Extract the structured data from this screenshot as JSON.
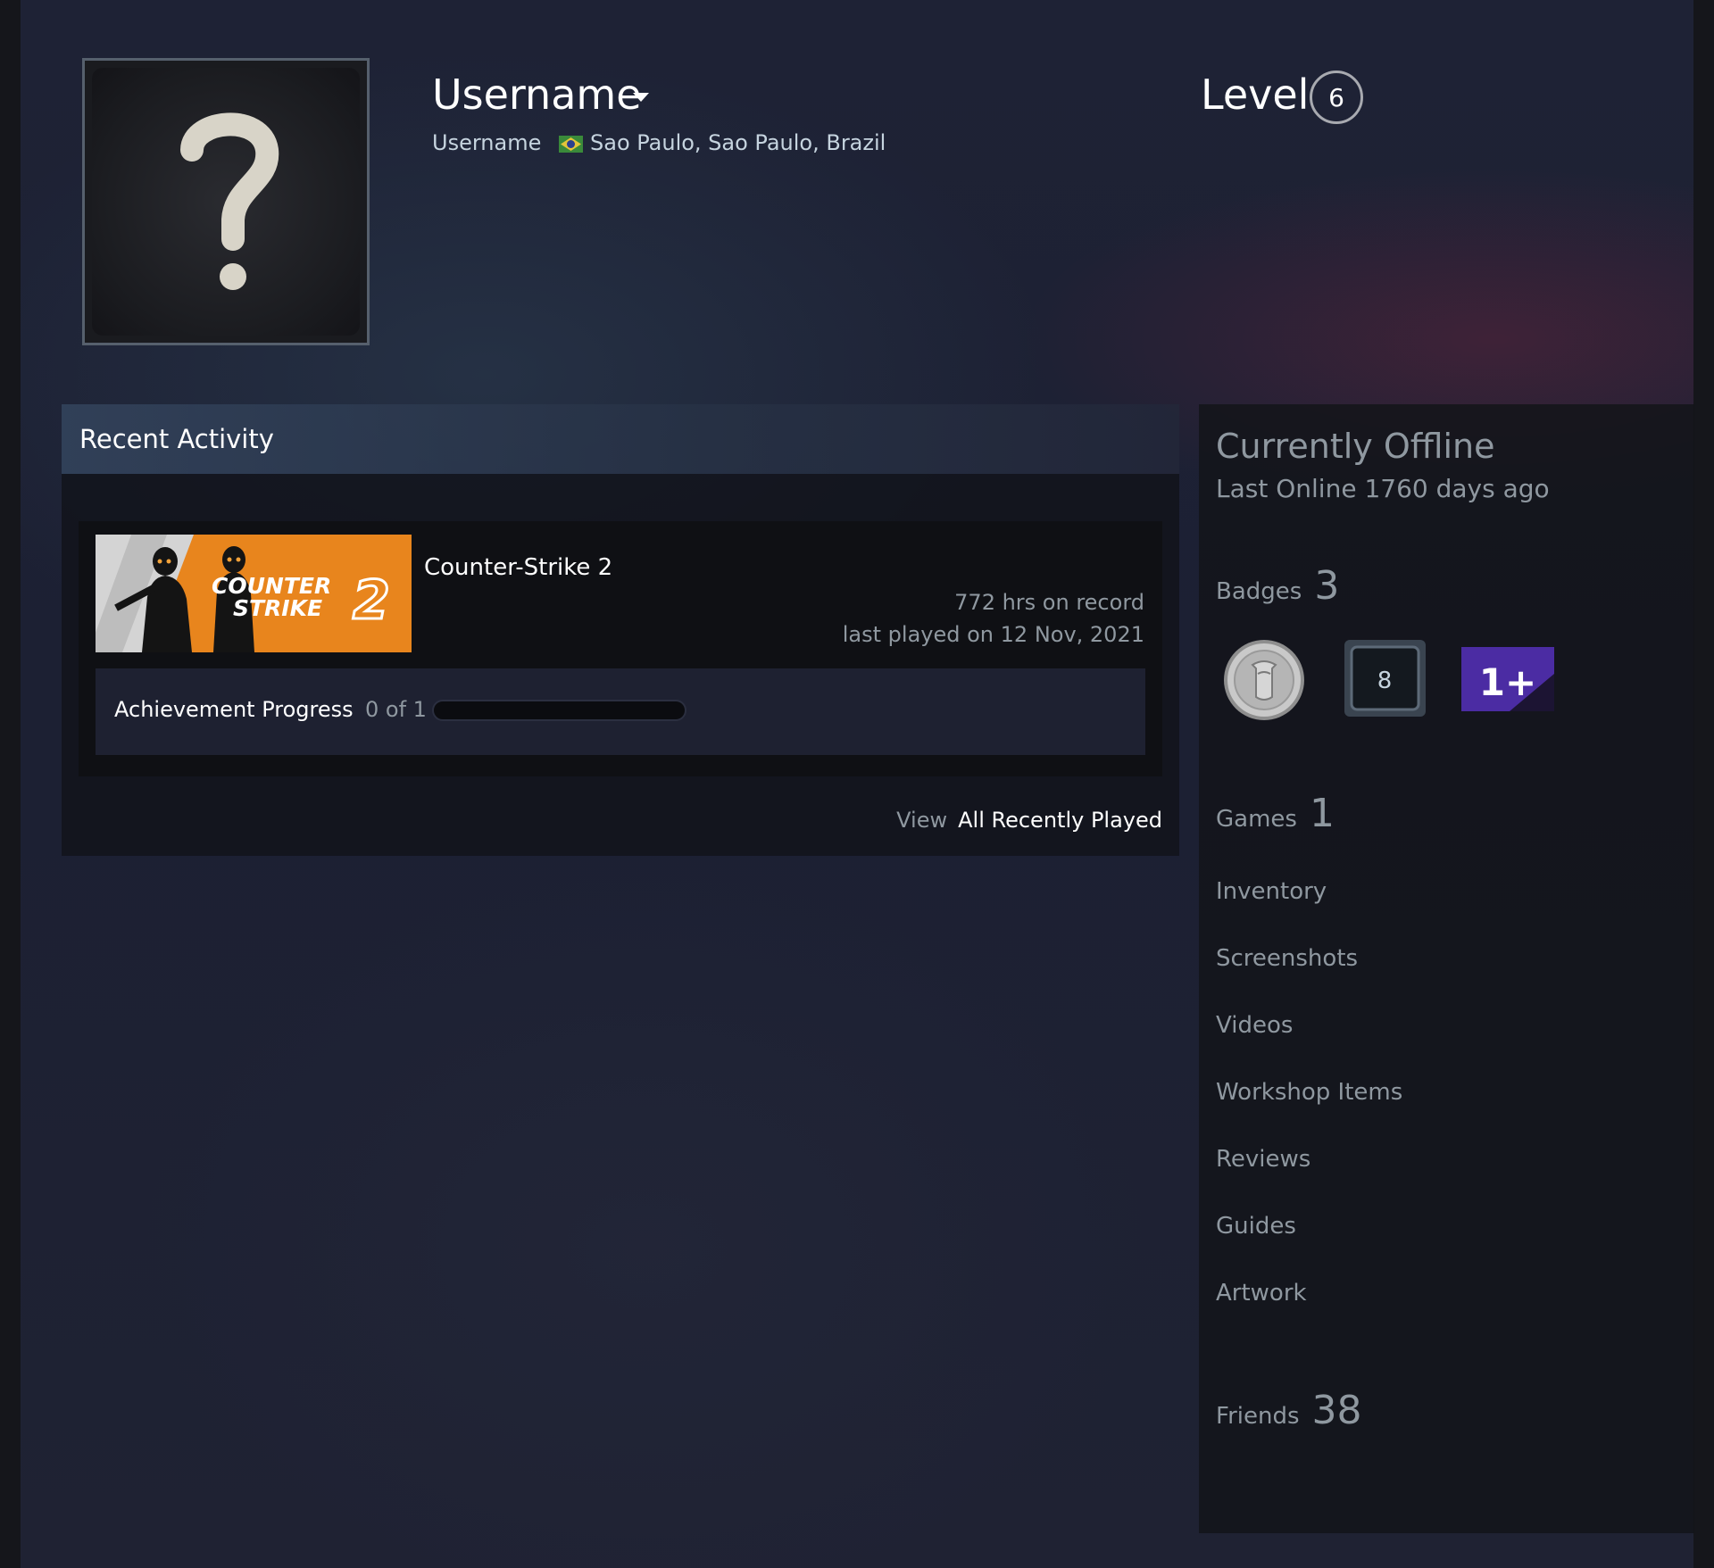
{
  "profile": {
    "persona_name": "Username",
    "real_name": "Username",
    "location": "Sao Paulo, Sao Paulo, Brazil",
    "level_label": "Level",
    "level": "6"
  },
  "recent_activity": {
    "title": "Recent Activity",
    "game": {
      "name": "Counter-Strike 2",
      "capsule_logo_line1": "COUNTER",
      "capsule_logo_line2": "STRIKE",
      "capsule_logo_num": "2",
      "hours": "772 hrs on record",
      "last_played": "last played on 12 Nov, 2021",
      "achievement_label": "Achievement Progress",
      "achievement_count": "0 of 1",
      "achievement_fraction": 0
    },
    "view_label": "View",
    "view_link": "All Recently Played"
  },
  "sidebar": {
    "status": "Currently Offline",
    "last_online": "Last Online 1760 days ago",
    "badges_label": "Badges",
    "badges_count": "3",
    "badge_icons": [
      "years-of-service-badge",
      "level-8-badge",
      "one-plus-badge"
    ],
    "badge_texts": [
      "8",
      "1+"
    ],
    "games_label": "Games",
    "games_count": "1",
    "links": [
      "Inventory",
      "Screenshots",
      "Videos",
      "Workshop Items",
      "Reviews",
      "Guides",
      "Artwork"
    ],
    "friends_label": "Friends",
    "friends_count": "38"
  },
  "colors": {
    "accent_orange": "#e8851d",
    "badge_purple": "#4b2ca3",
    "text_muted": "#8f98a0"
  }
}
